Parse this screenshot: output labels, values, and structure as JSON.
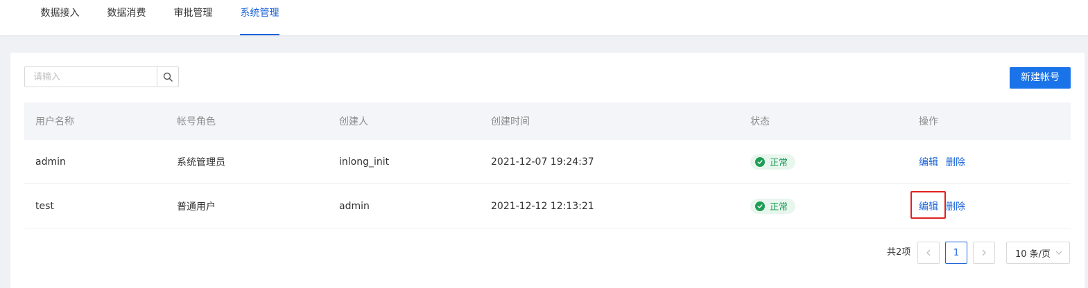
{
  "nav": {
    "tabs": [
      {
        "label": "数据接入",
        "active": false
      },
      {
        "label": "数据消费",
        "active": false
      },
      {
        "label": "审批管理",
        "active": false
      },
      {
        "label": "系统管理",
        "active": true
      }
    ]
  },
  "toolbar": {
    "search_placeholder": "请输入",
    "search_value": "",
    "search_icon": "search-icon",
    "create_label": "新建帐号"
  },
  "table": {
    "columns": [
      "用户名称",
      "帐号角色",
      "创建人",
      "创建时间",
      "状态",
      "操作"
    ],
    "rows": [
      {
        "username": "admin",
        "role": "系统管理员",
        "creator": "inlong_init",
        "created_at": "2021-12-07 19:24:37",
        "status": "正常",
        "edit": "编辑",
        "delete": "删除"
      },
      {
        "username": "test",
        "role": "普通用户",
        "creator": "admin",
        "created_at": "2021-12-12 12:13:21",
        "status": "正常",
        "edit": "编辑",
        "delete": "删除"
      }
    ]
  },
  "pagination": {
    "total_text": "共2项",
    "current_page": "1",
    "page_size": "10 条/页"
  },
  "colors": {
    "accent": "#1a63d8",
    "primary_button": "#1a73e8",
    "status_ok": "#1f9d55",
    "highlight": "#e02020"
  }
}
